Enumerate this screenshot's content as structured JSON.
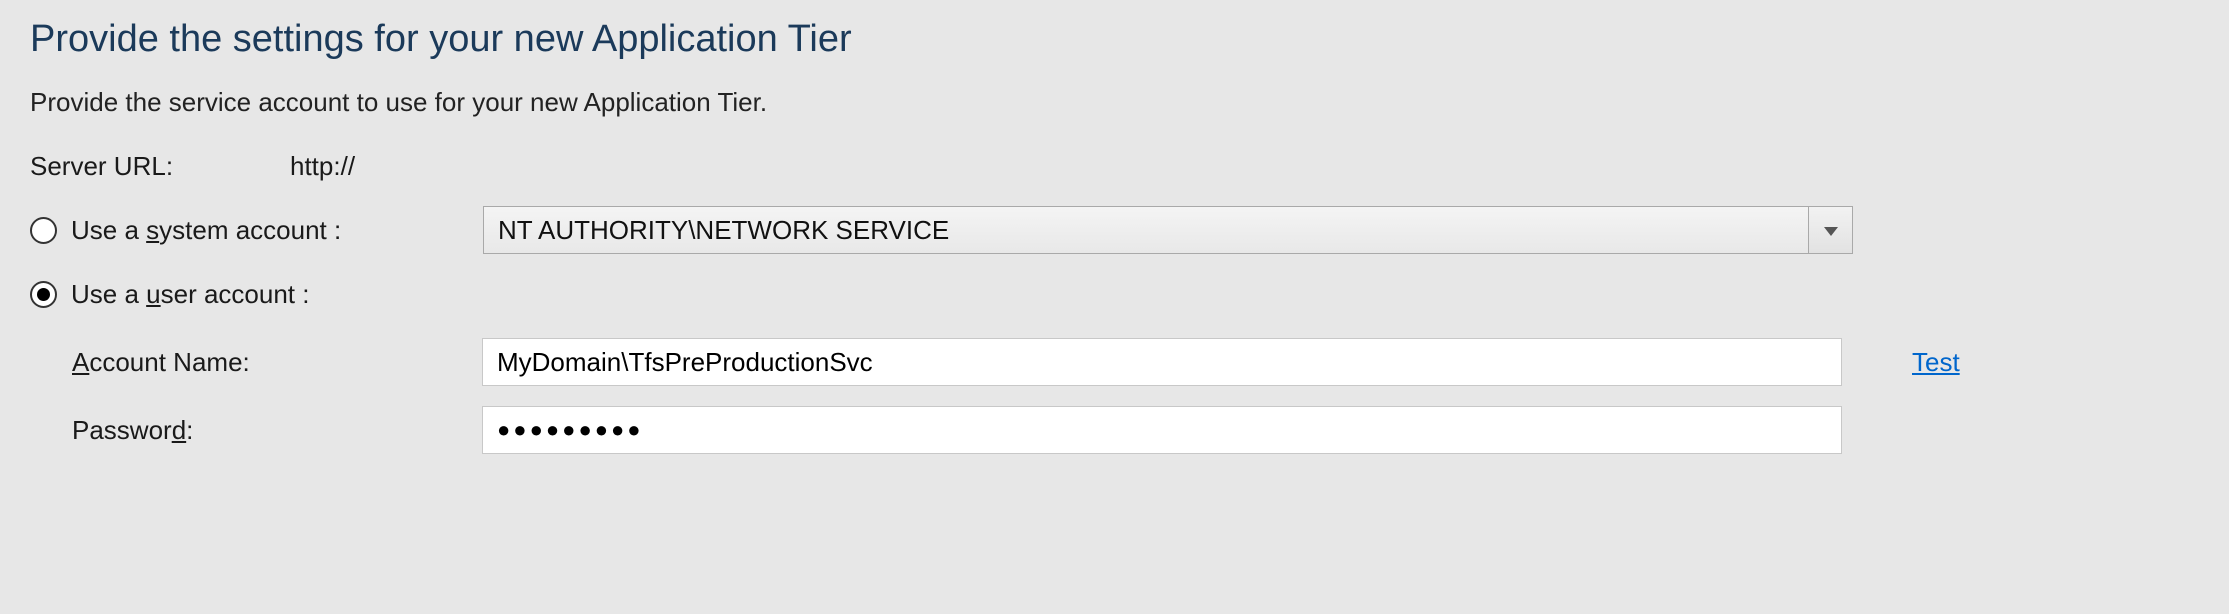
{
  "title": "Provide the settings for your new Application Tier",
  "subtitle": "Provide the service account to use for your new Application Tier.",
  "server": {
    "label": "Server URL:",
    "value": "http://"
  },
  "account": {
    "system_label_pre": "Use a ",
    "system_label_u": "s",
    "system_label_post": "ystem account :",
    "system_dropdown_value": "NT AUTHORITY\\NETWORK SERVICE",
    "user_label_pre": "Use a ",
    "user_label_u": "u",
    "user_label_post": "ser account :",
    "name_label_u": "A",
    "name_label_post": "ccount Name:",
    "name_value": "MyDomain\\TfsPreProductionSvc",
    "password_label_pre": "Passwor",
    "password_label_u": "d",
    "password_label_post": ":",
    "password_value": "●●●●●●●●●",
    "test_link": "Test"
  }
}
